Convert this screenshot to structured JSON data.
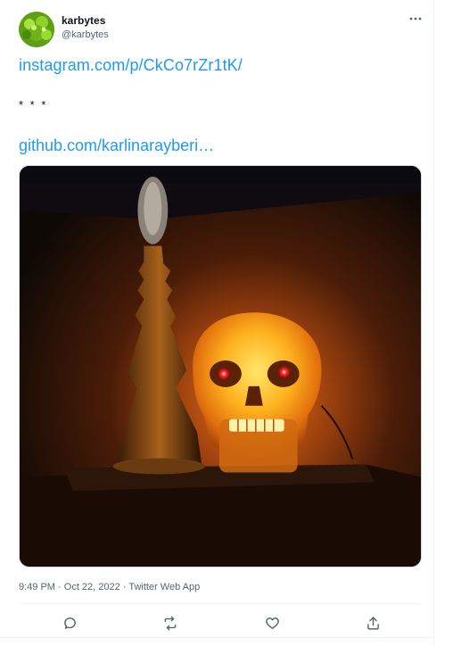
{
  "tweet": {
    "author_name": "karbytes",
    "author_handle": "@karbytes",
    "link1": "instagram.com/p/CkCo7rZr1tK/",
    "separator": "* * *",
    "link2": "github.com/karlinarayberi…",
    "time": "9:49 PM",
    "date": "Oct 22, 2022",
    "source": "Twitter Web App",
    "dot": "·"
  },
  "icons": {
    "more": "more-icon",
    "reply": "reply-icon",
    "retweet": "retweet-icon",
    "like": "like-icon",
    "share": "share-icon"
  },
  "colors": {
    "link": "#1d9bf0",
    "text": "#0f1419",
    "muted": "#536471",
    "glow": "#ff9a1a"
  }
}
